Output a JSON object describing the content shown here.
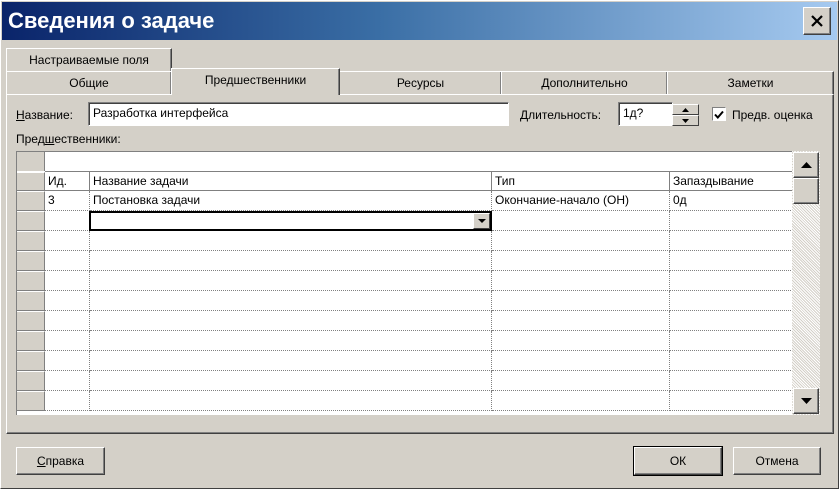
{
  "window": {
    "title": "Сведения о задаче"
  },
  "tabs": {
    "row_back": [
      {
        "label": "Настраиваемые поля"
      }
    ],
    "row_front": [
      {
        "label": "Общие"
      },
      {
        "label": "Предшественники"
      },
      {
        "label": "Ресурсы"
      },
      {
        "label": "Дополнительно"
      },
      {
        "label": "Заметки"
      }
    ],
    "active": "Предшественники"
  },
  "form": {
    "name_label": "Название:",
    "name_value": "Разработка интерфейса",
    "duration_label": "Длительность:",
    "duration_value": "1д?",
    "estimated_label": "Предв. оценка",
    "estimated_checked": true,
    "predecessors_label": "Предшественники:"
  },
  "grid": {
    "entry_value": "",
    "columns": [
      "Ид.",
      "Название задачи",
      "Тип",
      "Запаздывание"
    ],
    "rows": [
      {
        "id": "3",
        "name": "Постановка задачи",
        "type": "Окончание-начало (ОН)",
        "lag": "0д"
      },
      {
        "id": "",
        "name": "",
        "type": "",
        "lag": ""
      }
    ]
  },
  "buttons": {
    "help": "Справка",
    "ok": "ОК",
    "cancel": "Отмена"
  },
  "colors": {
    "face": "#d4d0c8",
    "title_start": "#0a246a",
    "title_end": "#a6caf0"
  }
}
